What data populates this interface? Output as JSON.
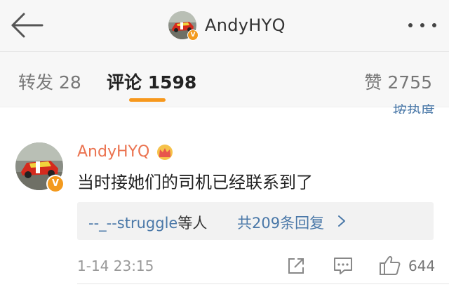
{
  "header": {
    "username": "AndyHYQ",
    "verified_badge": "V",
    "back_icon": "back-arrow-icon",
    "more_icon": "more-dots-icon"
  },
  "tabs": {
    "repost_label": "转发",
    "repost_count": "28",
    "comments_label": "评论",
    "comments_count": "1598",
    "likes_label": "赞",
    "likes_count": "2755",
    "active": "comments"
  },
  "sort_toggle": "按热度",
  "comment": {
    "username": "AndyHYQ",
    "crown_icon": "crown-icon",
    "verified_badge": "V",
    "text": "当时接她们的司机已经联系到了",
    "replies": {
      "who": "--_--struggle",
      "who_suffix": "等人",
      "count_text": "共209条回复"
    },
    "time": "1-14 23:15",
    "like_count": "644"
  },
  "colors": {
    "accent_orange": "#f7981c",
    "name_orange": "#eb7350",
    "link_blue": "#4a78a8",
    "header_bg": "#f7f7f7"
  }
}
